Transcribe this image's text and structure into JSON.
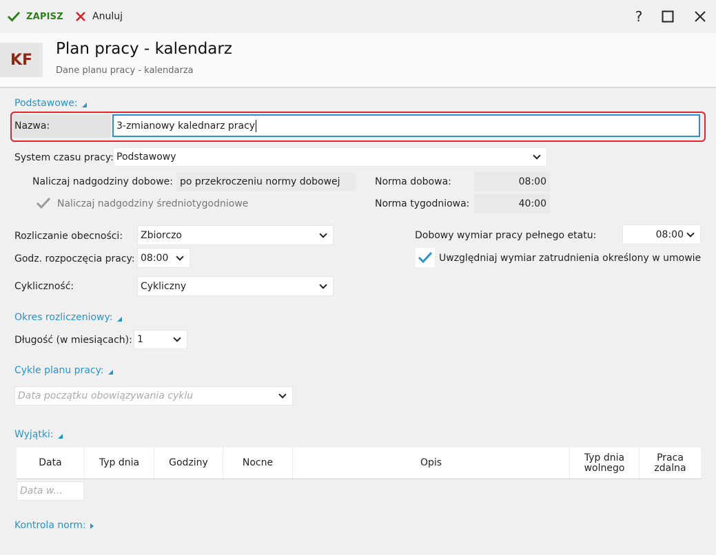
{
  "toolbar": {
    "save_label": "ZAPISZ",
    "cancel_label": "Anuluj",
    "help_label": "?"
  },
  "header": {
    "badge": "KF",
    "title": "Plan pracy - kalendarz",
    "subtitle": "Dane planu pracy - kalendarza"
  },
  "basic": {
    "section_label": "Podstawowe:",
    "name_label": "Nazwa:",
    "name_value": "3-zmianowy kalednarz pracy",
    "system_label": "System czasu pracy:",
    "system_value": "Podstawowy",
    "overtime_label": "Naliczaj nadgodziny dobowe:",
    "overtime_value": "po przekroczeniu normy dobowej",
    "avg_overtime_label": "Naliczaj nadgodziny średniotygodniowe",
    "daily_norm_label": "Norma dobowa:",
    "daily_norm_value": "08:00",
    "weekly_norm_label": "Norma tygodniowa:",
    "weekly_norm_value": "40:00",
    "attendance_label": "Rozliczanie obecności:",
    "attendance_value": "Zbiorczo",
    "start_hour_label": "Godz. rozpoczęcia pracy:",
    "start_hour_value": "08:00",
    "cyclic_label": "Cykliczność:",
    "cyclic_value": "Cykliczny",
    "fulltime_label": "Dobowy wymiar pracy pełnego etatu:",
    "fulltime_value": "08:00",
    "include_contract_label": "Uwzględniaj wymiar zatrudnienia określony w umowie"
  },
  "period": {
    "section_label": "Okres rozliczeniowy:",
    "length_label": "Długość (w miesiącach):",
    "length_value": "1"
  },
  "cycles": {
    "section_label": "Cykle planu pracy:",
    "start_placeholder": "Data początku obowiązywania cyklu"
  },
  "exceptions": {
    "section_label": "Wyjątki:",
    "columns": [
      "Data",
      "Typ dnia",
      "Godziny",
      "Nocne",
      "Opis",
      "Typ dnia wolnego",
      "Praca zdalna"
    ],
    "new_row_placeholder": "Data w..."
  },
  "norms": {
    "section_label": "Kontrola norm:"
  },
  "colors": {
    "accent": "#2a93c8",
    "save": "#2e7d1e",
    "cancel": "#d8232a",
    "highlight": "#e0262f"
  }
}
